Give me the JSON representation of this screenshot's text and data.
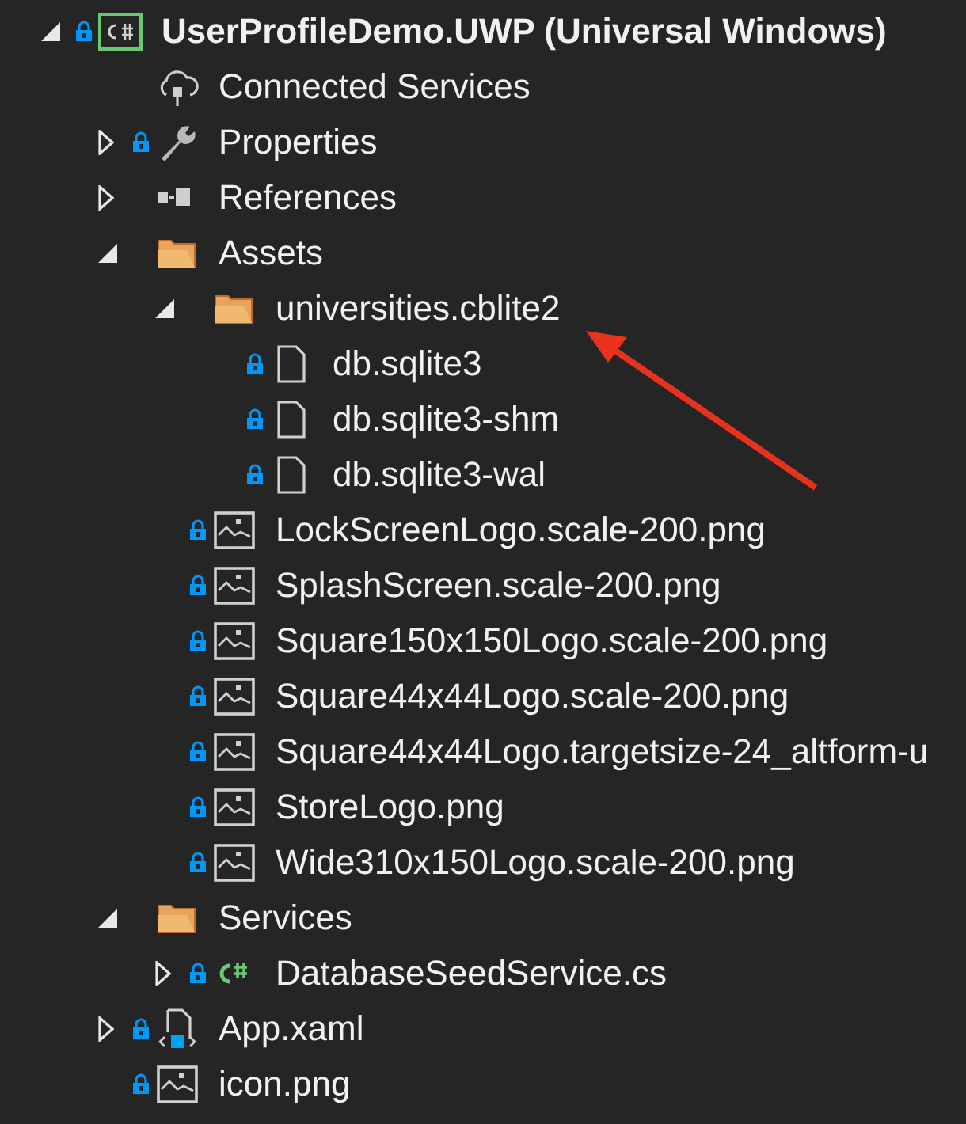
{
  "tree": [
    {
      "label": "UserProfileDemo.UWP (Universal Windows)",
      "kind": "csharp-project",
      "locked": true,
      "expanded": true,
      "children": [
        {
          "label": "Connected Services",
          "kind": "cloud",
          "locked": false
        },
        {
          "label": "Properties",
          "kind": "wrench",
          "locked": true,
          "expanded": false
        },
        {
          "label": "References",
          "kind": "references",
          "locked": false,
          "expanded": false
        },
        {
          "label": "Assets",
          "kind": "folder",
          "locked": false,
          "expanded": true,
          "children": [
            {
              "label": "universities.cblite2",
              "kind": "folder",
              "locked": false,
              "expanded": true,
              "children": [
                {
                  "label": "db.sqlite3",
                  "kind": "file",
                  "locked": true
                },
                {
                  "label": "db.sqlite3-shm",
                  "kind": "file",
                  "locked": true
                },
                {
                  "label": "db.sqlite3-wal",
                  "kind": "file",
                  "locked": true
                }
              ]
            },
            {
              "label": "LockScreenLogo.scale-200.png",
              "kind": "image",
              "locked": true
            },
            {
              "label": "SplashScreen.scale-200.png",
              "kind": "image",
              "locked": true
            },
            {
              "label": "Square150x150Logo.scale-200.png",
              "kind": "image",
              "locked": true
            },
            {
              "label": "Square44x44Logo.scale-200.png",
              "kind": "image",
              "locked": true
            },
            {
              "label": "Square44x44Logo.targetsize-24_altform-u",
              "kind": "image",
              "locked": true
            },
            {
              "label": "StoreLogo.png",
              "kind": "image",
              "locked": true
            },
            {
              "label": "Wide310x150Logo.scale-200.png",
              "kind": "image",
              "locked": true
            }
          ]
        },
        {
          "label": "Services",
          "kind": "folder",
          "locked": false,
          "expanded": true,
          "children": [
            {
              "label": "DatabaseSeedService.cs",
              "kind": "csharp",
              "locked": true,
              "expanded": false
            }
          ]
        },
        {
          "label": "App.xaml",
          "kind": "xaml",
          "locked": true,
          "expanded": false
        },
        {
          "label": "icon.png",
          "kind": "image",
          "locked": true
        }
      ]
    }
  ]
}
